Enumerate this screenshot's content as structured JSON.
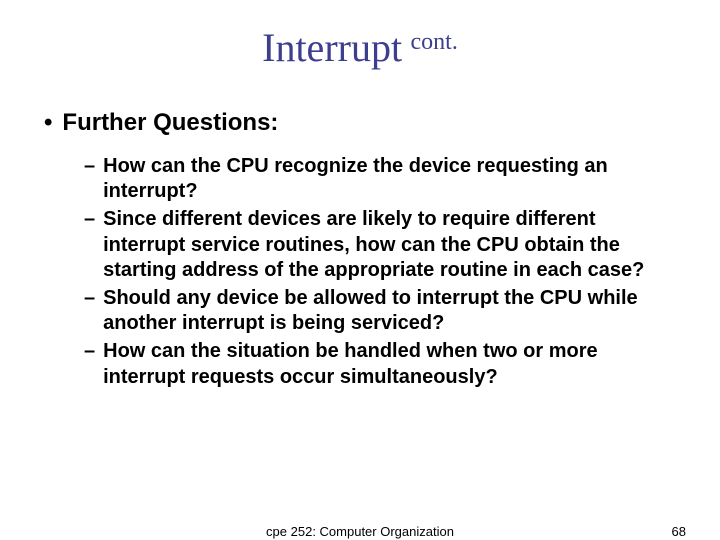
{
  "title": {
    "main": "Interrupt",
    "sup": "cont."
  },
  "heading": "Further Questions:",
  "questions": [
    "How can the CPU recognize the device requesting an interrupt?",
    "Since different devices are likely to require different interrupt service routines, how can the CPU obtain the starting address of the appropriate routine in each case?",
    "Should any device be allowed to interrupt the CPU while another interrupt is being serviced?",
    "How can the situation be handled when two or more interrupt requests occur simultaneously?"
  ],
  "footer": {
    "course": "cpe 252: Computer Organization",
    "page": "68"
  },
  "bullets": {
    "level1": "•",
    "level2": "–"
  }
}
